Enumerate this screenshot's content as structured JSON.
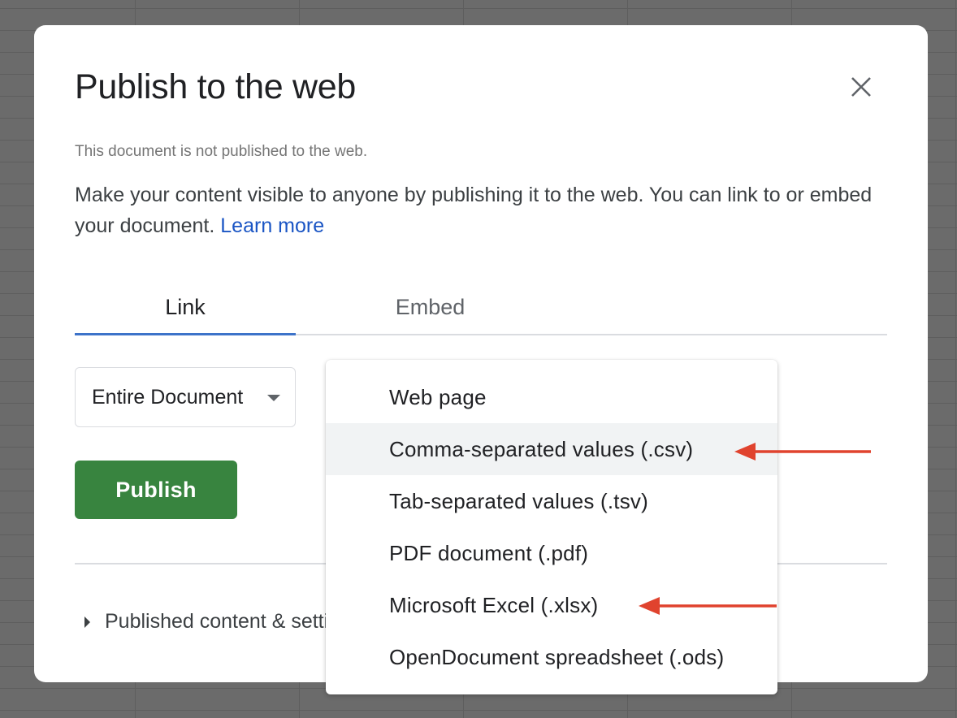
{
  "dialog": {
    "title": "Publish to the web",
    "status": "This document is not published to the web.",
    "description": "Make your content visible to anyone by publishing it to the web. You can link to or embed your document.",
    "learn_more": "Learn more",
    "tabs": [
      {
        "label": "Link",
        "selected": true
      },
      {
        "label": "Embed",
        "selected": false
      }
    ],
    "scope_select": {
      "value": "Entire Document"
    },
    "publish_button": "Publish",
    "published_content_label": "Published content & settings"
  },
  "format_menu": {
    "items": [
      {
        "label": "Web page"
      },
      {
        "label": "Comma-separated values (.csv)",
        "highlighted": true
      },
      {
        "label": "Tab-separated values (.tsv)"
      },
      {
        "label": "PDF document (.pdf)"
      },
      {
        "label": "Microsoft Excel (.xlsx)"
      },
      {
        "label": "OpenDocument spreadsheet (.ods)"
      }
    ]
  },
  "colors": {
    "accent_blue": "#3d73c9",
    "publish_green": "#38843f",
    "link_blue": "#1a55c4",
    "annotation_red": "#e0432e"
  },
  "icons": [
    "close-icon",
    "dropdown-caret-icon",
    "expand-triangle-icon"
  ]
}
